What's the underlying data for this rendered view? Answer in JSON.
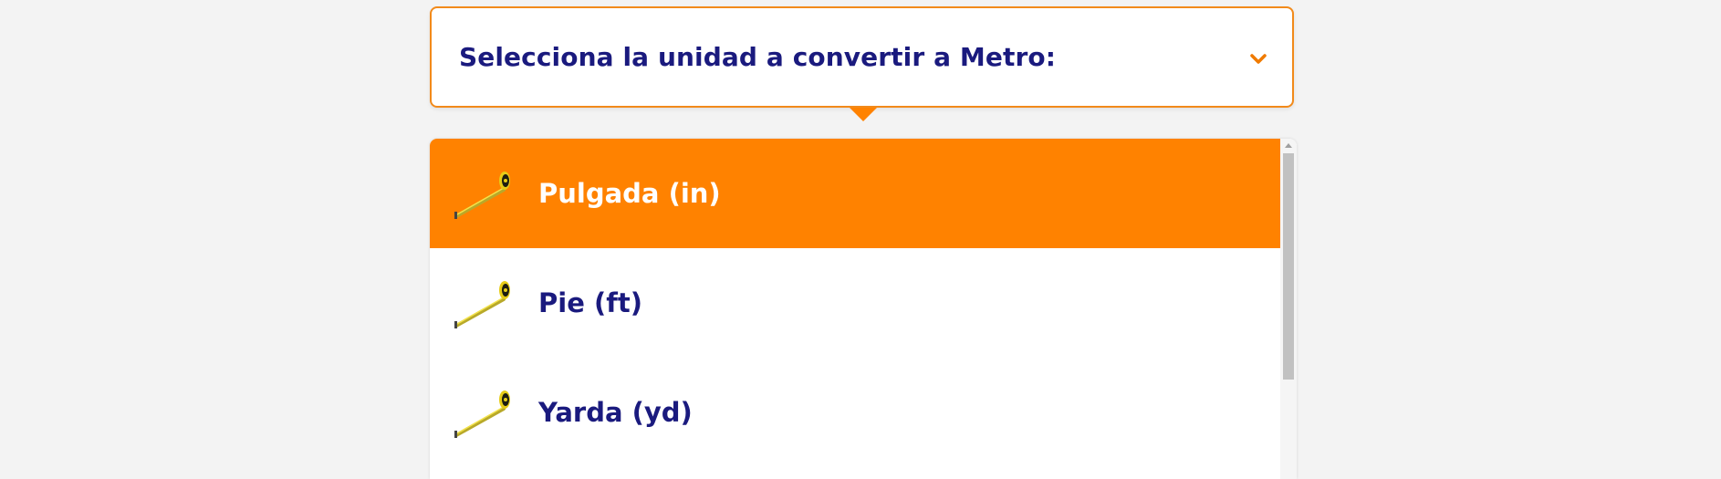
{
  "selector": {
    "label": "Selecciona la unidad a convertir a Metro:",
    "icon": "chevron-down-icon"
  },
  "colors": {
    "accent": "#ff8200",
    "text": "#1a1a7e",
    "selected_text": "#ffffff",
    "background": "#f3f3f3"
  },
  "units": [
    {
      "label": "Pulgada (in)",
      "icon": "tape-measure-icon",
      "selected": true
    },
    {
      "label": "Pie (ft)",
      "icon": "tape-measure-icon",
      "selected": false
    },
    {
      "label": "Yarda (yd)",
      "icon": "tape-measure-icon",
      "selected": false
    }
  ]
}
